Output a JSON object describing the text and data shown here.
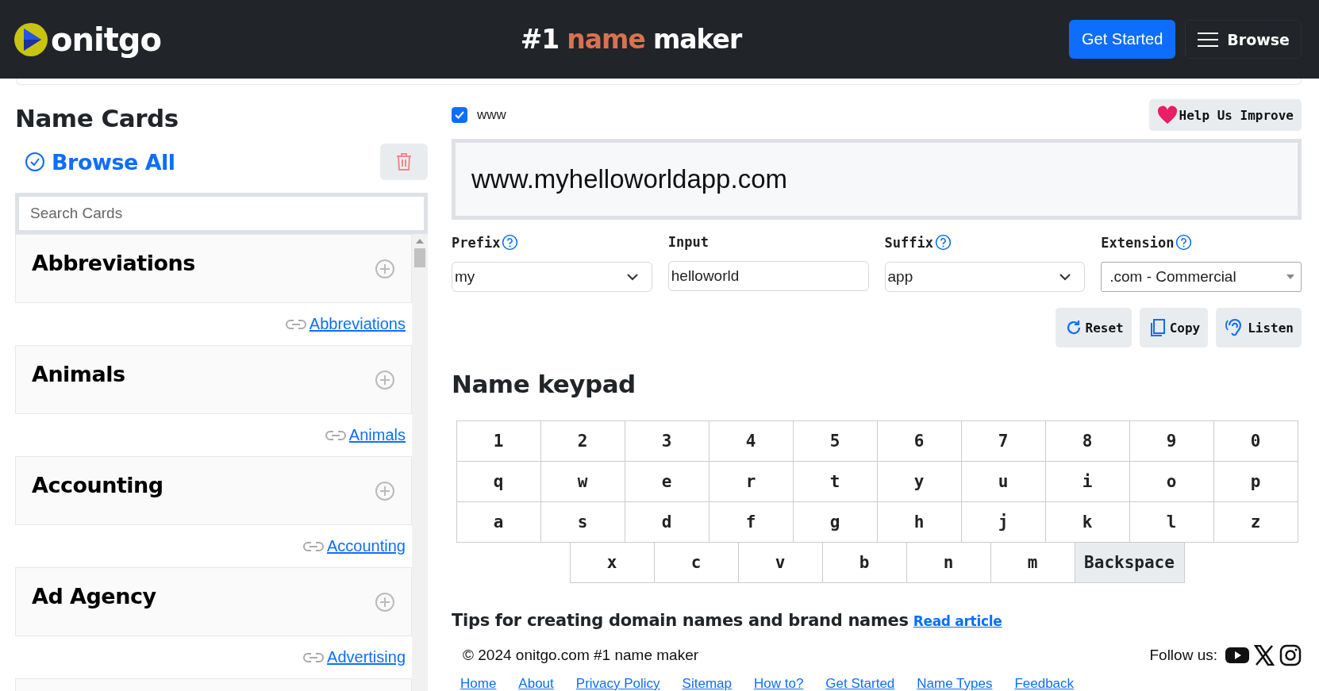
{
  "header": {
    "logo": "onitgo",
    "tagline": [
      {
        "text": "#1",
        "accent": false
      },
      {
        "text": "name",
        "accent": true
      },
      {
        "text": "maker",
        "accent": false
      }
    ],
    "get_started": "Get Started",
    "browse": "Browse"
  },
  "sidebar": {
    "title": "Name Cards",
    "browse_all": "Browse All",
    "search": {
      "placeholder": "Search Cards"
    },
    "cards": [
      {
        "title": "Abbreviations",
        "link": "Abbreviations"
      },
      {
        "title": "Animals",
        "link": "Animals"
      },
      {
        "title": "Accounting",
        "link": "Accounting"
      },
      {
        "title": "Ad Agency",
        "link": "Advertising"
      }
    ]
  },
  "www": {
    "label": "www",
    "checked": true
  },
  "help": "Help Us Improve",
  "domain": "www.myhelloworldapp.com",
  "fields": [
    {
      "label": "Prefix",
      "help": true,
      "kind": "select",
      "value": "my"
    },
    {
      "label": "Input",
      "help": false,
      "kind": "input",
      "value": "helloworld"
    },
    {
      "label": "Suffix",
      "help": true,
      "kind": "select",
      "value": "app"
    },
    {
      "label": "Extension",
      "help": true,
      "kind": "dropdown",
      "value": ".com - Commercial"
    }
  ],
  "actions": [
    {
      "label": "Reset",
      "kind": "reset"
    },
    {
      "label": "Copy",
      "kind": "copy"
    },
    {
      "label": "Listen",
      "kind": "listen"
    }
  ],
  "keypad": {
    "title": "Name keypad",
    "rows": [
      [
        "1",
        "2",
        "3",
        "4",
        "5",
        "6",
        "7",
        "8",
        "9",
        "0"
      ],
      [
        "q",
        "w",
        "e",
        "r",
        "t",
        "y",
        "u",
        "i",
        "o",
        "p"
      ],
      [
        "a",
        "s",
        "d",
        "f",
        "g",
        "h",
        "j",
        "k",
        "l",
        "z"
      ]
    ],
    "bottom_row": [
      {
        "label": "x",
        "kind": "char"
      },
      {
        "label": "c",
        "kind": "char"
      },
      {
        "label": "v",
        "kind": "char"
      },
      {
        "label": "b",
        "kind": "char"
      },
      {
        "label": "n",
        "kind": "char"
      },
      {
        "label": "m",
        "kind": "char"
      },
      {
        "label": "Backspace",
        "kind": "backspace"
      }
    ]
  },
  "tips": {
    "text": "Tips for creating domain names and brand names",
    "link": "Read article"
  },
  "footer": {
    "copyright": "© 2024 onitgo.com #1 name maker",
    "follow": "Follow us:",
    "links": [
      "Home",
      "About",
      "Privacy Policy",
      "Sitemap",
      "How to?",
      "Get Started",
      "Name Types",
      "Feedback"
    ]
  }
}
